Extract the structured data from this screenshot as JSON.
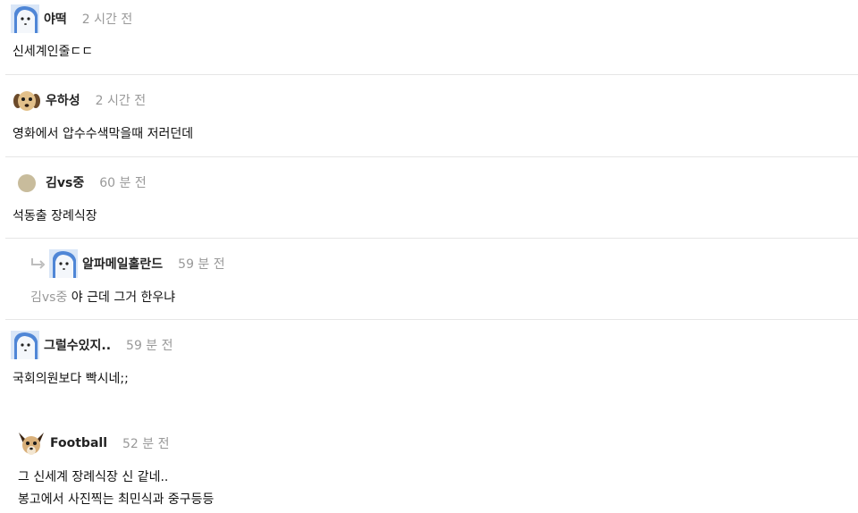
{
  "comments": [
    {
      "author": "야떡",
      "time": "2 시간 전",
      "avatar_icon": "ghost-face-avatar",
      "lines": [
        "신세계인줄ㄷㄷ"
      ]
    },
    {
      "author": "우하성",
      "time": "2 시간 전",
      "avatar_icon": "puppy-avatar",
      "lines": [
        "영화에서 압수수색막을때 저러던데"
      ]
    },
    {
      "author": "김vs중",
      "time": "60 분 전",
      "avatar_icon": "beige-circle-avatar",
      "lines": [
        "석동출 장례식장"
      ]
    },
    {
      "author": "알파메일홀란드",
      "time": "59 분 전",
      "avatar_icon": "ghost-face-avatar",
      "is_reply": true,
      "reply_to": "김vs중",
      "lines": [
        "야 근데 그거 한우냐"
      ]
    },
    {
      "author": "그럴수있지..",
      "time": "59 분 전",
      "avatar_icon": "ghost-face-avatar",
      "lines": [
        "국회의원보다 빡시네;;"
      ]
    },
    {
      "author": "Football",
      "time": "52 분 전",
      "avatar_icon": "chihuahua-avatar",
      "lines": [
        "그 신세계 장례식장 신 같네..",
        "봉고에서 사진찍는 최민식과 중구등등"
      ]
    }
  ],
  "colors": {
    "text": "#111111",
    "muted": "#999999",
    "divider": "#e6e6e6",
    "avatar_blue": "#5b8fd9",
    "avatar_beige": "#c8bc9c"
  }
}
